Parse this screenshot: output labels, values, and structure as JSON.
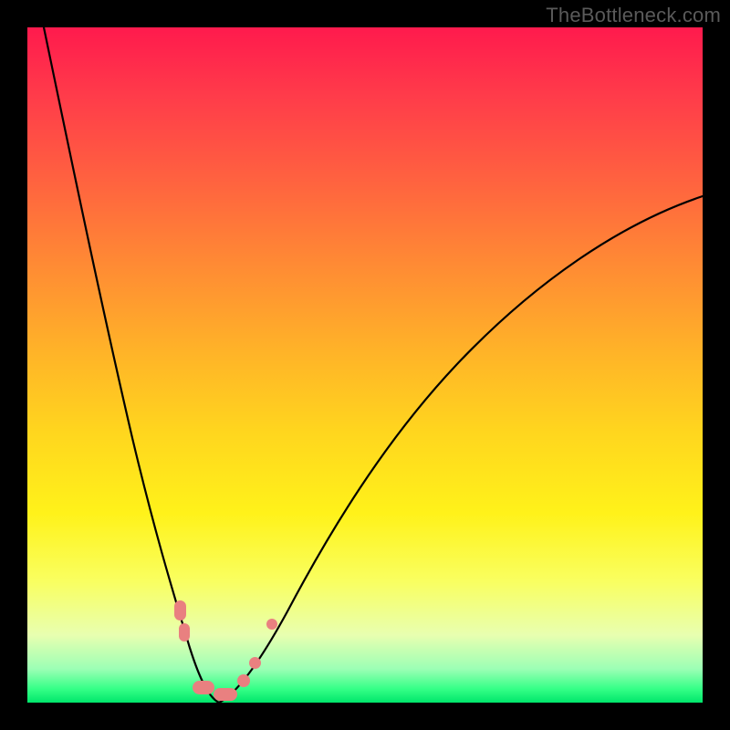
{
  "watermark": "TheBottleneck.com",
  "colors": {
    "frame_bg": "#000000",
    "gradient_top": "#ff1a4d",
    "gradient_mid": "#ffd61e",
    "gradient_bottom": "#00e66b",
    "curve": "#000000",
    "highlight": "#e98080",
    "watermark": "#5a5a5a"
  },
  "chart_data": {
    "type": "line",
    "title": "",
    "xlabel": "",
    "ylabel": "",
    "xlim": [
      0,
      100
    ],
    "ylim": [
      0,
      100
    ],
    "note": "Two curves descending steeply to a minimum near x≈25 (y≈0) then rising; color gradient encodes bottleneck severity (red=high, green=low).",
    "series": [
      {
        "name": "left-branch",
        "x": [
          2,
          5,
          8,
          11,
          14,
          17,
          20,
          22,
          24,
          26,
          28
        ],
        "y": [
          100,
          92,
          82,
          71,
          58,
          44,
          28,
          15,
          5,
          1,
          0
        ]
      },
      {
        "name": "right-branch",
        "x": [
          28,
          31,
          35,
          40,
          46,
          53,
          62,
          72,
          83,
          95,
          100
        ],
        "y": [
          0,
          3,
          10,
          20,
          32,
          44,
          55,
          63,
          69,
          73,
          75
        ]
      }
    ],
    "highlights": [
      {
        "x": 22,
        "y": 15
      },
      {
        "x": 22.5,
        "y": 10
      },
      {
        "x": 25,
        "y": 2
      },
      {
        "x": 27,
        "y": 0
      },
      {
        "x": 30,
        "y": 1
      },
      {
        "x": 33,
        "y": 6
      },
      {
        "x": 35,
        "y": 11
      }
    ]
  }
}
